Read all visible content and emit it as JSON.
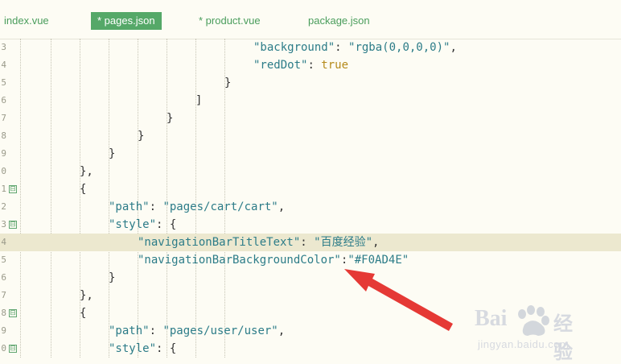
{
  "tabs": [
    {
      "label": "index.vue",
      "active": false
    },
    {
      "label": "* pages.json",
      "active": true
    },
    {
      "label": "* product.vue",
      "active": false
    },
    {
      "label": "package.json",
      "active": false
    }
  ],
  "lines": [
    {
      "num": "3",
      "fold": false,
      "text": "\"background\": \"rgba(0,0,0,0)\","
    },
    {
      "num": "4",
      "fold": false,
      "text": "\"redDot\": true"
    },
    {
      "num": "5",
      "fold": false,
      "text": "}"
    },
    {
      "num": "6",
      "fold": false,
      "text": "]"
    },
    {
      "num": "7",
      "fold": false,
      "text": "}"
    },
    {
      "num": "8",
      "fold": false,
      "text": "}"
    },
    {
      "num": "9",
      "fold": false,
      "text": "}"
    },
    {
      "num": "0",
      "fold": false,
      "text": "},"
    },
    {
      "num": "1",
      "fold": true,
      "text": "{"
    },
    {
      "num": "2",
      "fold": false,
      "text": "\"path\": \"pages/cart/cart\","
    },
    {
      "num": "3",
      "fold": true,
      "text": "\"style\": {"
    },
    {
      "num": "4",
      "fold": false,
      "text": "\"navigationBarTitleText\": \"百度经验\","
    },
    {
      "num": "5",
      "fold": false,
      "text": "\"navigationBarBackgroundColor\":\"#F0AD4E\""
    },
    {
      "num": "6",
      "fold": false,
      "text": "}"
    },
    {
      "num": "7",
      "fold": false,
      "text": "},"
    },
    {
      "num": "8",
      "fold": true,
      "text": "{"
    },
    {
      "num": "9",
      "fold": false,
      "text": "\"path\": \"pages/user/user\","
    },
    {
      "num": "0",
      "fold": true,
      "text": "\"style\": {"
    }
  ],
  "fold_glyph": "⊟",
  "watermark": {
    "brand_left": "Bai",
    "brand_right": "经验",
    "url": "jingyan.baidu.com"
  },
  "colors": {
    "background": "#fdfcf4",
    "active_tab": "#55a868",
    "tab_text": "#4a9d5c",
    "key_text": "#2c7c88",
    "bool_text": "#b58a1b",
    "highlight_line": "#ece8cf",
    "arrow": "#e53935"
  },
  "icons": [
    "fold-toggle-icon",
    "annotation-arrow",
    "baidu-paw-icon"
  ]
}
